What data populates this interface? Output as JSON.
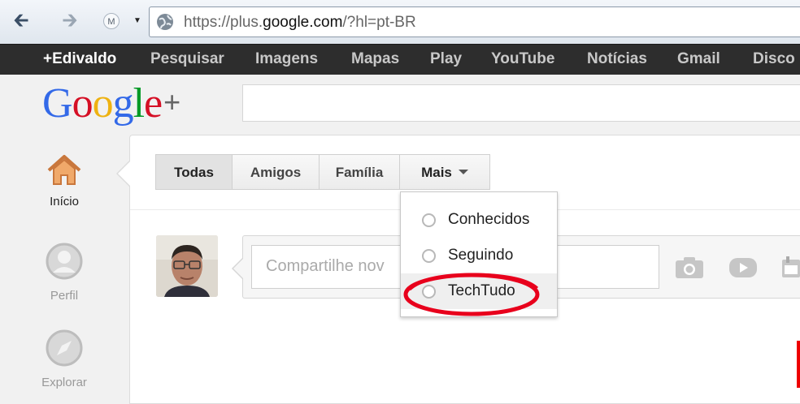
{
  "browser": {
    "url_prefix": "https://plus.",
    "url_domain": "google.com",
    "url_suffix": "/?hl=pt-BR",
    "extension_letter": "M"
  },
  "gbar": {
    "items": [
      "+Edivaldo",
      "Pesquisar",
      "Imagens",
      "Mapas",
      "Play",
      "YouTube",
      "Notícias",
      "Gmail",
      "Disco"
    ]
  },
  "logo": {
    "text": "Google",
    "plus": "+"
  },
  "leftnav": {
    "home": "Início",
    "profile": "Perfil",
    "explore": "Explorar"
  },
  "tabs": {
    "all": "Todas",
    "friends": "Amigos",
    "family": "Família",
    "more": "Mais"
  },
  "share": {
    "placeholder": "Compartilhe nov"
  },
  "dropdown": {
    "items": [
      "Conhecidos",
      "Seguindo",
      "TechTudo"
    ]
  },
  "colors": {
    "gbar_bg": "#2d2d2d",
    "highlight_ellipse": "#e8001c",
    "google_blue": "#3369e8",
    "google_red": "#d50f25",
    "google_yellow": "#eeb211",
    "google_green": "#009925"
  },
  "icons": [
    "back-arrow-icon",
    "forward-arrow-icon",
    "globe-icon",
    "home-icon",
    "profile-icon",
    "compass-icon",
    "camera-icon",
    "video-icon",
    "event-icon",
    "chevron-down-icon"
  ]
}
